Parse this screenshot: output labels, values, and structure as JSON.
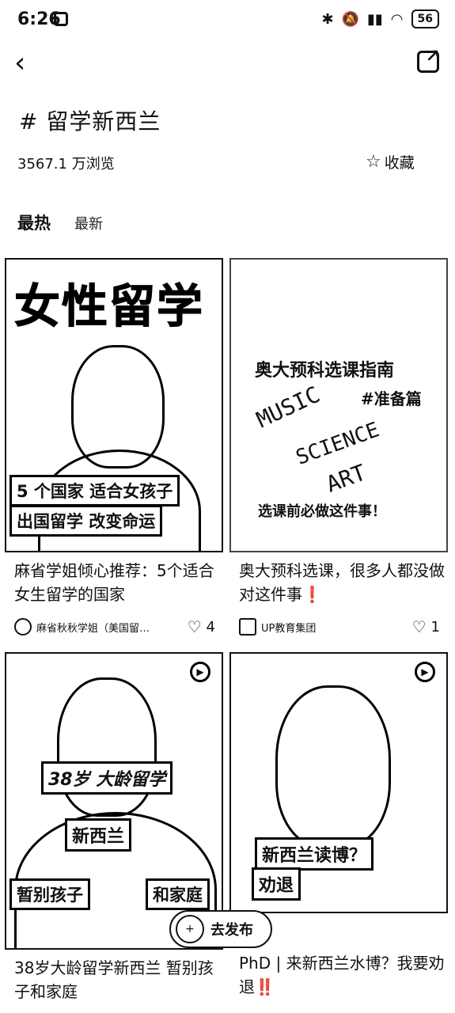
{
  "status": {
    "time": "6:26",
    "battery": "56"
  },
  "header": {
    "back_glyph": "‹",
    "share_glyph": "↗"
  },
  "topic": {
    "title": "# 留学新西兰",
    "views": "3567.1 万浏览",
    "fav_label": "收藏",
    "fav_glyph": "☆"
  },
  "tabs": [
    {
      "label": "最热"
    },
    {
      "label": "最新"
    }
  ],
  "cards": [
    {
      "thumb_texts": [
        "女性留学",
        "5 个国家 适合女孩子",
        "出国留学 改变命运"
      ],
      "caption": "麻省学姐倾心推荐：5个适合女生留学的国家",
      "author": "麻省秋秋学姐（美国留…",
      "likes": "4"
    },
    {
      "thumb_texts": [
        "奥大预科选课指南",
        "#准备篇",
        "选课前必做这件事！",
        "MUSIC",
        "ART",
        "SCIENCE"
      ],
      "caption": "奥大预科选课，很多人都没做对这件事❗️",
      "author": "UP教育集团",
      "likes": "1"
    },
    {
      "thumb_texts": [
        "38岁 大龄留学",
        "新西兰",
        "暂别孩子",
        "和家庭"
      ],
      "caption": "38岁大龄留学新西兰 暂别孩子和家庭"
    },
    {
      "thumb_texts": [
        "新西兰读博？",
        "劝退"
      ],
      "caption": "PhD | 来新西兰水博？我要劝退‼️"
    }
  ],
  "post_button": {
    "label": "去发布",
    "icon_text": "+"
  },
  "icons": {
    "back": "back-arrow-icon",
    "share": "share-icon",
    "star": "star-icon",
    "heart": "heart-icon",
    "play": "play-icon"
  }
}
